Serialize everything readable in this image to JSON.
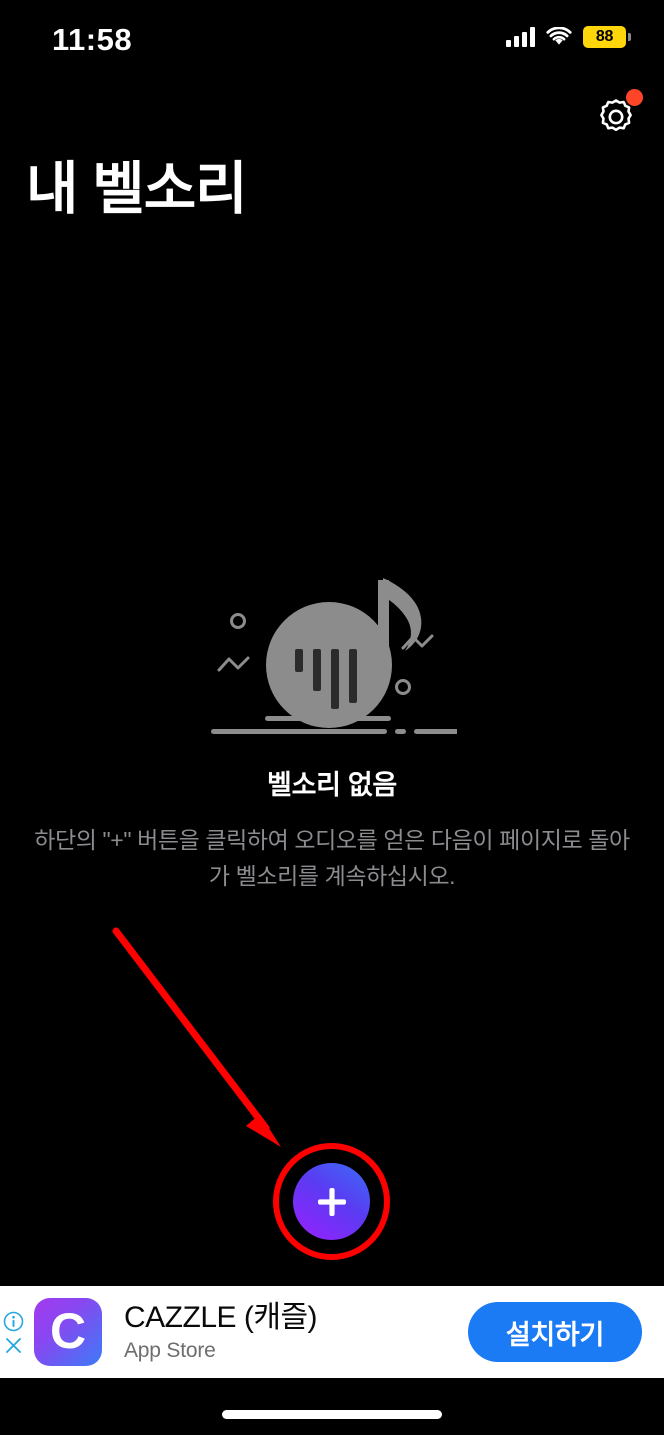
{
  "status_bar": {
    "time": "11:58",
    "battery_level": "88",
    "battery_color": "#FFD60A",
    "signal_icon": "cellular-signal-icon",
    "wifi_icon": "wifi-icon"
  },
  "header": {
    "title": "내 벨소리",
    "settings_icon": "gear-icon",
    "notification_dot_color": "#FF4528"
  },
  "empty_state": {
    "illustration": "music-note-illustration",
    "title": "벨소리 없음",
    "description": "하단의 \"+\" 버튼을 클릭하여 오디오를 얻은 다음이 페이지로 돌아가 벨소리를 계속하십시오."
  },
  "fab": {
    "icon": "plus-icon",
    "gradient_start": "#3A6DF6",
    "gradient_end": "#9A20FF"
  },
  "annotation": {
    "ring_color": "#FF0000",
    "arrow_color": "#FF0000"
  },
  "ad": {
    "icon_letter": "C",
    "title": "CAZZLE (캐즐)",
    "subtitle": "App Store",
    "cta_label": "설치하기",
    "cta_color": "#1B7BF5",
    "info_icon": "info-circle-icon",
    "close_icon": "close-icon"
  }
}
